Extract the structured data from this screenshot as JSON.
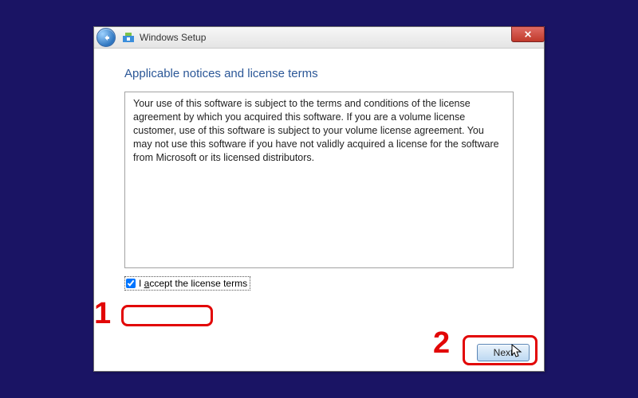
{
  "window": {
    "title": "Windows Setup"
  },
  "content": {
    "heading": "Applicable notices and license terms",
    "license_text": "Your use of this software is subject to the terms and conditions of the license agreement by which you acquired this software.  If you are a volume license customer, use of this software is subject to your volume license agreement.  You may not use this software if you have not validly acquired a license for the software from Microsoft or its licensed distributors."
  },
  "accept": {
    "label_pre": "I ",
    "label_u": "a",
    "label_post": "ccept the license terms",
    "checked": true
  },
  "buttons": {
    "next": "Next"
  },
  "annotations": {
    "one": "1",
    "two": "2"
  }
}
